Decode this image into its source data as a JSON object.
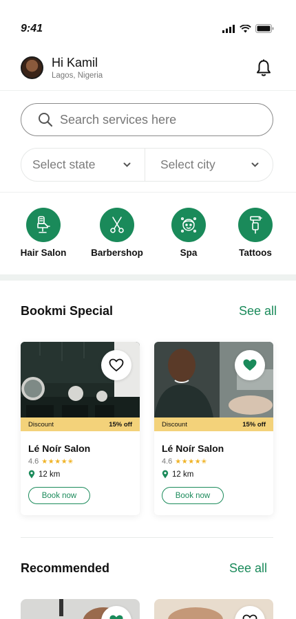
{
  "status": {
    "time": "9:41"
  },
  "header": {
    "greeting": "Hi Kamil",
    "location": "Lagos, Nigeria"
  },
  "search": {
    "placeholder": "Search services here"
  },
  "filters": {
    "state": "Select state",
    "city": "Select city"
  },
  "categories": [
    {
      "label": "Hair Salon",
      "icon": "barber-chair-icon"
    },
    {
      "label": "Barbershop",
      "icon": "scissors-icon"
    },
    {
      "label": "Spa",
      "icon": "spa-face-icon"
    },
    {
      "label": "Tattoos",
      "icon": "tattoo-machine-icon"
    }
  ],
  "special": {
    "title": "Bookmi Special",
    "see_all": "See all",
    "cards": [
      {
        "discount_label": "Discount",
        "discount": "15% off",
        "name": "Lé Noír Salon",
        "rating": "4.6",
        "stars": 4.5,
        "distance": "12 km",
        "book": "Book now",
        "favorited": false
      },
      {
        "discount_label": "Discount",
        "discount": "15% off",
        "name": "Lé Noír Salon",
        "rating": "4.6",
        "stars": 4.5,
        "distance": "12 km",
        "book": "Book now",
        "favorited": true
      }
    ]
  },
  "recommended": {
    "title": "Recommended",
    "see_all": "See all"
  },
  "colors": {
    "accent": "#1a8a5a",
    "discount_bg": "#f3d27a",
    "star": "#f0b429"
  }
}
